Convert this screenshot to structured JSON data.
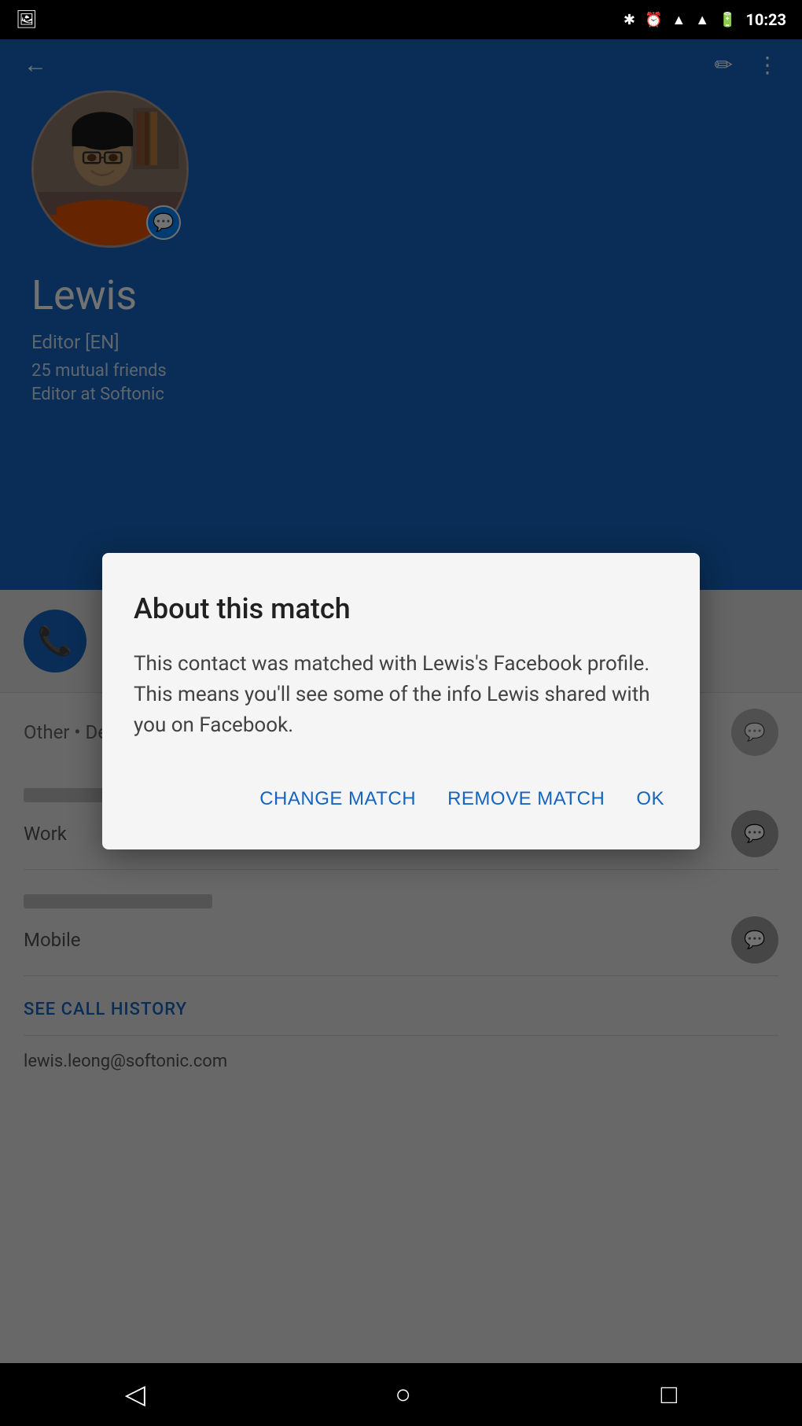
{
  "statusBar": {
    "time": "10:23",
    "icons": [
      "gallery",
      "bluetooth",
      "clock",
      "wifi",
      "signal",
      "battery"
    ]
  },
  "topNav": {
    "backLabel": "←",
    "editIcon": "✏",
    "moreIcon": "⋮"
  },
  "profile": {
    "name": "Lewis",
    "role": "Editor [EN]",
    "mutualFriends": "25 mutual friends",
    "workplace": "Editor at Softonic",
    "messengerBadge": "💬"
  },
  "contactInfo": {
    "other": "Other",
    "default": "Default",
    "work": "Work",
    "mobile": "Mobile",
    "seeCallHistory": "SEE CALL HISTORY",
    "email": "lewis.leong@softonic.com"
  },
  "modal": {
    "title": "About this match",
    "body": "This contact was matched with Lewis's Facebook profile. This means you'll see some of the info Lewis shared with you on Facebook.",
    "changeMatchBtn": "CHANGE MATCH",
    "removeMatchBtn": "REMOVE MATCH",
    "okBtn": "OK"
  },
  "bottomNav": {
    "backIcon": "◁",
    "homeIcon": "○",
    "recentIcon": "□"
  }
}
